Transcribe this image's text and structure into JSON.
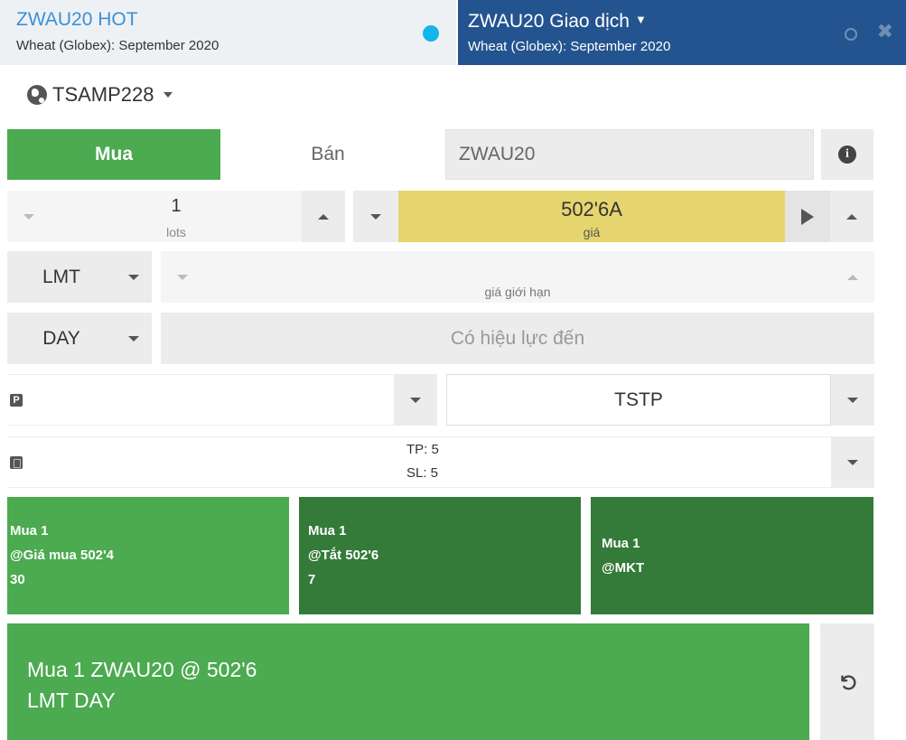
{
  "tabs": {
    "left": {
      "title": "ZWAU20 HOT",
      "subtitle": "Wheat (Globex): September 2020"
    },
    "right": {
      "title": "ZWAU20 Giao dịch",
      "subtitle": "Wheat (Globex): September 2020"
    }
  },
  "account": {
    "name": "TSAMP228"
  },
  "side": {
    "buy_label": "Mua",
    "sell_label": "Bán",
    "selected": "Mua"
  },
  "symbol": {
    "value": "ZWAU20"
  },
  "quantity": {
    "value": "1",
    "unit": "lots"
  },
  "price": {
    "value": "502'6A",
    "unit": "giá"
  },
  "order_type": {
    "value": "LMT"
  },
  "limit_price": {
    "value": "",
    "unit": "giá giới hạn"
  },
  "duration": {
    "value": "DAY",
    "valid_until_placeholder": "Có hiệu lực đến"
  },
  "strategy": {
    "value": "TSTP"
  },
  "bracket": {
    "tp": "TP: 5",
    "sl": "SL: 5"
  },
  "quick": [
    {
      "line1": "Mua 1",
      "line2": "@Giá mua 502'4",
      "line3": "30"
    },
    {
      "line1": "Mua 1",
      "line2": "@Tắt 502'6",
      "line3": "7"
    },
    {
      "line1": "Mua 1",
      "line2": "@MKT"
    }
  ],
  "submit": {
    "line1": "Mua 1 ZWAU20 @ 502'6",
    "line2": "LMT DAY"
  },
  "colors": {
    "buy": "#4caa50",
    "buy_dark": "#347a38",
    "price_bg": "#e6d56f",
    "header_active": "#24548f",
    "link": "#3d8fd6",
    "status_dot": "#13b5ea"
  }
}
